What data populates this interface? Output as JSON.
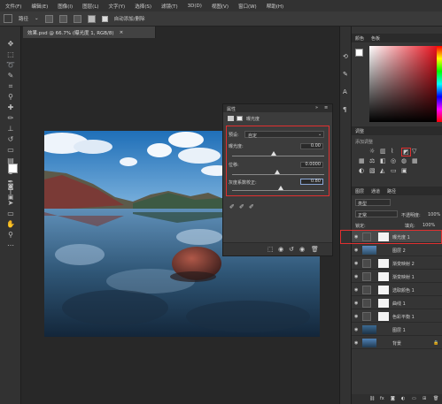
{
  "menu": [
    "文件(F)",
    "编辑(E)",
    "图像(I)",
    "图层(L)",
    "文字(Y)",
    "选择(S)",
    "滤镜(T)",
    "3D(D)",
    "视图(V)",
    "窗口(W)",
    "帮助(H)"
  ],
  "options_bar": {
    "mode_label": "路径",
    "auto_add_delete": "自动添加/删除"
  },
  "document_tab": {
    "title": "效果.psd @ 66.7% (曝光度 1, RGB/8)",
    "close": "×"
  },
  "properties_panel": {
    "tab": "属性",
    "type_label": "曝光度",
    "preset_label": "预设:",
    "preset_value": "自定",
    "exposure_label": "曝光度:",
    "exposure_value": "0.00",
    "offset_label": "位移:",
    "offset_value": "0.0000",
    "gamma_label": "灰度系数校正:",
    "gamma_value": "0.80"
  },
  "color_panel": {
    "tab_color": "颜色",
    "tab_swatches": "色板"
  },
  "adjustments_panel": {
    "tab": "调整",
    "subtitle": "添加调整"
  },
  "layers_panel": {
    "tab_layers": "图层",
    "tab_channels": "通道",
    "tab_paths": "路径",
    "filter_kind": "类型",
    "blend_mode": "正常",
    "opacity_label": "不透明度:",
    "opacity_value": "100%",
    "lock_label": "锁定:",
    "fill_label": "填充:",
    "fill_value": "100%",
    "layers": [
      {
        "name": "曝光度 1"
      },
      {
        "name": "图层 2"
      },
      {
        "name": "渐变映射 2"
      },
      {
        "name": "渐变映射 1"
      },
      {
        "name": "选取颜色 1"
      },
      {
        "name": "曲线 1"
      },
      {
        "name": "色彩平衡 1"
      },
      {
        "name": "图层 1"
      },
      {
        "name": "背景"
      }
    ]
  },
  "colors": {
    "highlight_red": "#e03030",
    "panel_bg": "#3c3c3c",
    "app_bg": "#282828"
  }
}
